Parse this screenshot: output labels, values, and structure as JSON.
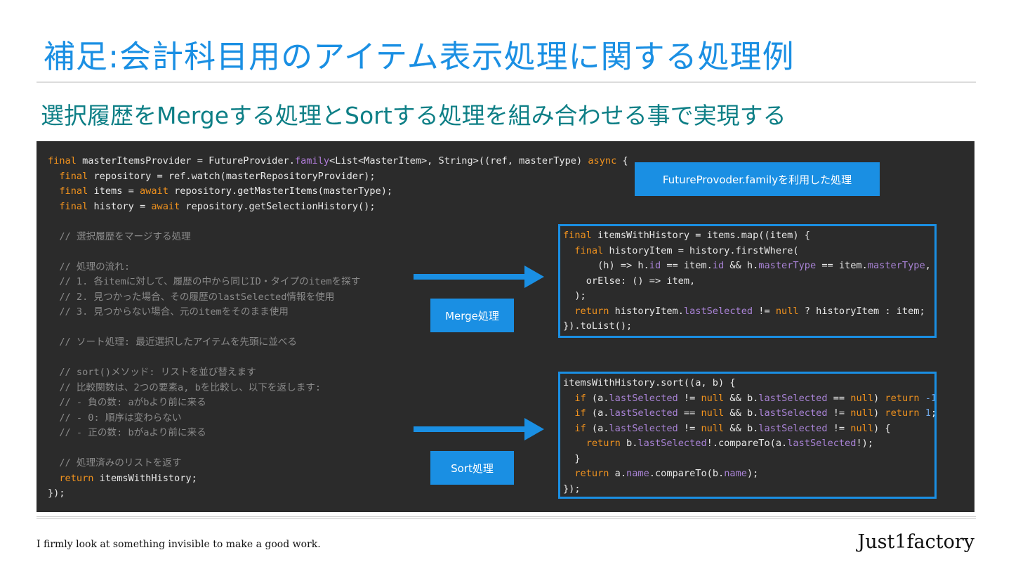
{
  "slide": {
    "title": "補足:会計科目用のアイテム表示処理に関する処理例",
    "subtitle": "選択履歴をMergeする処理とSortする処理を組み合わせる事で実現する"
  },
  "labels": {
    "family": "FutureProvoder.familyを利用した処理",
    "merge": "Merge処理",
    "sort": "Sort処理"
  },
  "code": {
    "main": [
      [
        [
          "final",
          "kw"
        ],
        [
          " masterItemsProvider = FutureProvider.",
          ""
        ],
        [
          "family",
          "fam"
        ],
        [
          "<List<MasterItem>, String>((ref, masterType) ",
          ""
        ],
        [
          "async",
          "kw"
        ],
        [
          " {",
          ""
        ]
      ],
      [
        [
          "  ",
          ""
        ],
        [
          "final",
          "kw"
        ],
        [
          " repository = ref.watch(masterRepositoryProvider);",
          ""
        ]
      ],
      [
        [
          "  ",
          ""
        ],
        [
          "final",
          "kw"
        ],
        [
          " items = ",
          ""
        ],
        [
          "await",
          "kw"
        ],
        [
          " repository.getMasterItems(masterType);",
          ""
        ]
      ],
      [
        [
          "  ",
          ""
        ],
        [
          "final",
          "kw"
        ],
        [
          " history = ",
          ""
        ],
        [
          "await",
          "kw"
        ],
        [
          " repository.getSelectionHistory();",
          ""
        ]
      ],
      [
        [
          "",
          ""
        ]
      ],
      [
        [
          "  // 選択履歴をマージする処理",
          "cm"
        ]
      ],
      [
        [
          "",
          ""
        ]
      ],
      [
        [
          "  // 処理の流れ:",
          "cm"
        ]
      ],
      [
        [
          "  // 1. 各itemに対して、履歴の中から同じID・タイプのitemを探す",
          "cm"
        ]
      ],
      [
        [
          "  // 2. 見つかった場合、その履歴のlastSelected情報を使用",
          "cm"
        ]
      ],
      [
        [
          "  // 3. 見つからない場合、元のitemをそのまま使用",
          "cm"
        ]
      ],
      [
        [
          "",
          ""
        ]
      ],
      [
        [
          "  // ソート処理: 最近選択したアイテムを先頭に並べる",
          "cm"
        ]
      ],
      [
        [
          "",
          ""
        ]
      ],
      [
        [
          "  // sort()メソッド: リストを並び替えます",
          "cm"
        ]
      ],
      [
        [
          "  // 比較関数は、2つの要素a, bを比較し、以下を返します:",
          "cm"
        ]
      ],
      [
        [
          "  // - 負の数: aがbより前に来る",
          "cm"
        ]
      ],
      [
        [
          "  // - 0: 順序は変わらない",
          "cm"
        ]
      ],
      [
        [
          "  // - 正の数: bがaより前に来る",
          "cm"
        ]
      ],
      [
        [
          "",
          ""
        ]
      ],
      [
        [
          "  // 処理済みのリストを返す",
          "cm"
        ]
      ],
      [
        [
          "  ",
          ""
        ],
        [
          "return",
          "kw"
        ],
        [
          " itemsWithHistory;",
          ""
        ]
      ],
      [
        [
          "});",
          ""
        ]
      ]
    ],
    "merge": [
      [
        [
          "final",
          "kw"
        ],
        [
          " itemsWithHistory = items.map((item) {",
          ""
        ]
      ],
      [
        [
          "  ",
          ""
        ],
        [
          "final",
          "kw"
        ],
        [
          " historyItem = history.firstWhere(",
          ""
        ]
      ],
      [
        [
          "      (h) => h.",
          ""
        ],
        [
          "id",
          "prop"
        ],
        [
          " == item.",
          ""
        ],
        [
          "id",
          "prop"
        ],
        [
          " && h.",
          ""
        ],
        [
          "masterType",
          "prop"
        ],
        [
          " == item.",
          ""
        ],
        [
          "masterType",
          "prop"
        ],
        [
          ",",
          ""
        ]
      ],
      [
        [
          "    orElse: () => item,",
          ""
        ]
      ],
      [
        [
          "  );",
          ""
        ]
      ],
      [
        [
          "  ",
          ""
        ],
        [
          "return",
          "kw"
        ],
        [
          " historyItem.",
          ""
        ],
        [
          "lastSelected",
          "prop"
        ],
        [
          " != ",
          ""
        ],
        [
          "null",
          "kw"
        ],
        [
          " ? historyItem : item;",
          ""
        ]
      ],
      [
        [
          "}).toList();",
          ""
        ]
      ]
    ],
    "sort": [
      [
        [
          "itemsWithHistory.sort((a, b) {",
          ""
        ]
      ],
      [
        [
          "  ",
          ""
        ],
        [
          "if",
          "kw"
        ],
        [
          " (a.",
          ""
        ],
        [
          "lastSelected",
          "prop"
        ],
        [
          " != ",
          ""
        ],
        [
          "null",
          "kw"
        ],
        [
          " && b.",
          ""
        ],
        [
          "lastSelected",
          "prop"
        ],
        [
          " == ",
          ""
        ],
        [
          "null",
          "kw"
        ],
        [
          ") ",
          ""
        ],
        [
          "return",
          "kw"
        ],
        [
          " ",
          ""
        ],
        [
          "-1",
          "num"
        ],
        [
          ";",
          ""
        ]
      ],
      [
        [
          "  ",
          ""
        ],
        [
          "if",
          "kw"
        ],
        [
          " (a.",
          ""
        ],
        [
          "lastSelected",
          "prop"
        ],
        [
          " == ",
          ""
        ],
        [
          "null",
          "kw"
        ],
        [
          " && b.",
          ""
        ],
        [
          "lastSelected",
          "prop"
        ],
        [
          " != ",
          ""
        ],
        [
          "null",
          "kw"
        ],
        [
          ") ",
          ""
        ],
        [
          "return",
          "kw"
        ],
        [
          " ",
          ""
        ],
        [
          "1",
          "num"
        ],
        [
          ";",
          ""
        ]
      ],
      [
        [
          "  ",
          ""
        ],
        [
          "if",
          "kw"
        ],
        [
          " (a.",
          ""
        ],
        [
          "lastSelected",
          "prop"
        ],
        [
          " != ",
          ""
        ],
        [
          "null",
          "kw"
        ],
        [
          " && b.",
          ""
        ],
        [
          "lastSelected",
          "prop"
        ],
        [
          " != ",
          ""
        ],
        [
          "null",
          "kw"
        ],
        [
          ") {",
          ""
        ]
      ],
      [
        [
          "    ",
          ""
        ],
        [
          "return",
          "kw"
        ],
        [
          " b.",
          ""
        ],
        [
          "lastSelected",
          "prop"
        ],
        [
          "!.compareTo(a.",
          ""
        ],
        [
          "lastSelected",
          "prop"
        ],
        [
          "!);",
          ""
        ]
      ],
      [
        [
          "  }",
          ""
        ]
      ],
      [
        [
          "  ",
          ""
        ],
        [
          "return",
          "kw"
        ],
        [
          " a.",
          ""
        ],
        [
          "name",
          "prop"
        ],
        [
          ".compareTo(b.",
          ""
        ],
        [
          "name",
          "prop"
        ],
        [
          ");",
          ""
        ]
      ],
      [
        [
          "});",
          ""
        ]
      ]
    ]
  },
  "footer": {
    "tagline": "I firmly look at something invisible to make a good work.",
    "brand": "Just1factory"
  },
  "colors": {
    "accent": "#1a8fe3",
    "subtitle": "#0e7f86",
    "code_bg": "#2b2b2b",
    "keyword": "#f0921e",
    "property": "#a983d6",
    "number": "#6fa6e4",
    "comment": "#8a8a8a"
  }
}
